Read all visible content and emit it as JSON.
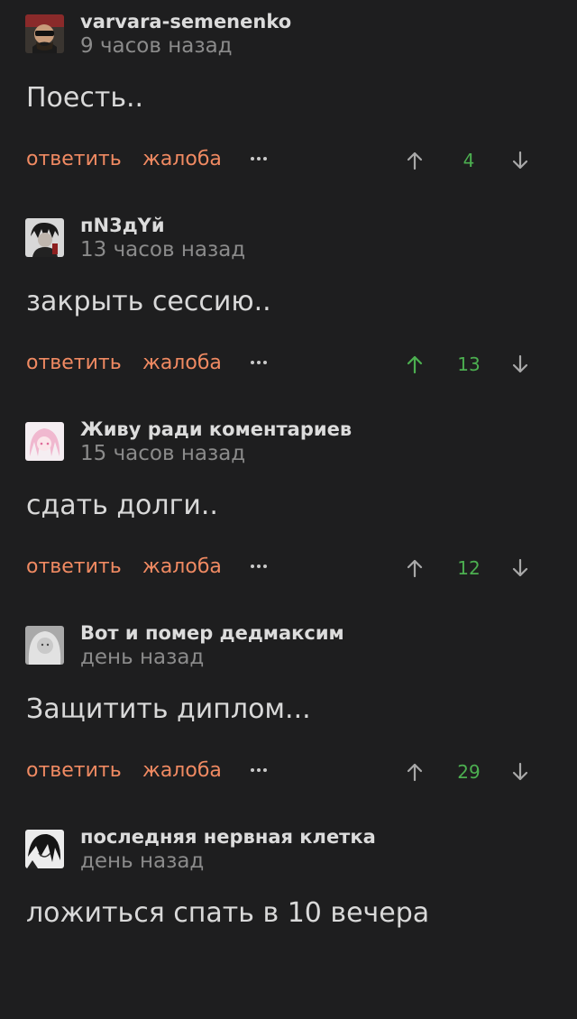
{
  "actions": {
    "reply": "ответить",
    "report": "жалоба"
  },
  "colors": {
    "background": "#1e1e1f",
    "action": "#f08a62",
    "score": "#4caf50",
    "upvoted": "#4caf50",
    "arrow": "#a8a8a8"
  },
  "comments": [
    {
      "username": "varvara-semenenko",
      "time": "9 часов назад",
      "text": "Поесть..",
      "score": "4",
      "upvoted": false
    },
    {
      "username": "пN3дYй",
      "time": "13 часов назад",
      "text": "закрыть сессию..",
      "score": "13",
      "upvoted": true
    },
    {
      "username": "Живу ради коментариев",
      "time": "15 часов назад",
      "text": "сдать долги..",
      "score": "12",
      "upvoted": false
    },
    {
      "username": "Вот и помер дедмаксим",
      "time": "день назад",
      "text": "Защитить диплом...",
      "score": "29",
      "upvoted": false
    },
    {
      "username": "последняя нервная клетка",
      "time": "день назад",
      "text": "ложиться спать в 10 вечера",
      "score": "",
      "upvoted": false
    }
  ]
}
